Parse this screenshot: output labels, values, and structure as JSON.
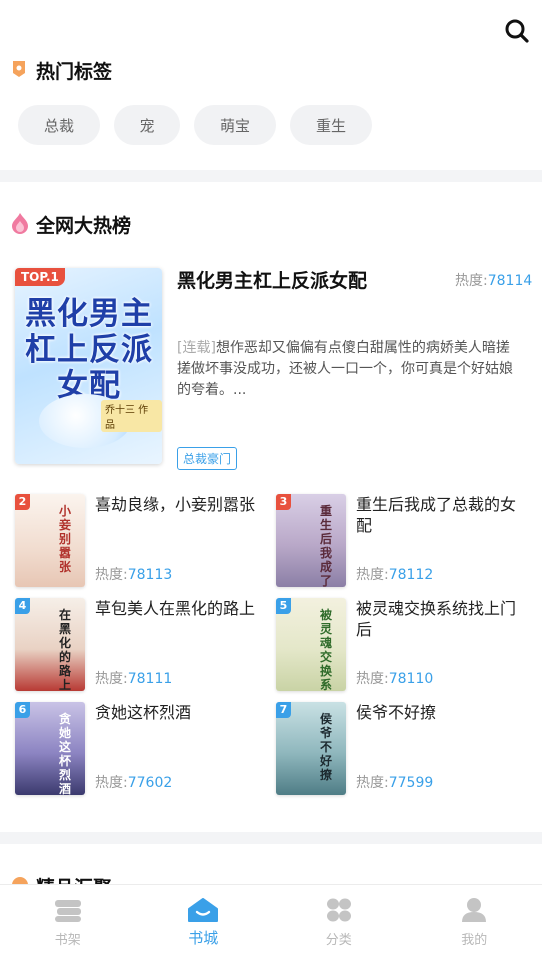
{
  "hot_tags": {
    "title": "热门标签",
    "tags": [
      "总裁",
      "宠",
      "萌宝",
      "重生"
    ]
  },
  "ranking": {
    "title": "全网大热榜",
    "heat_label": "热度:",
    "top1": {
      "badge": "TOP.1",
      "cover_text": "黑化男主杠上反派女配",
      "cover_author": "乔十三 作品",
      "title": "黑化男主杠上反派女配",
      "heat": "78114",
      "status": "[连载]",
      "description": "想作恶却又偏偏有点傻白甜属性的病娇美人暗搓搓做坏事没成功，还被人一口一个，你可真是个好姑娘的夸着。...",
      "category": "总裁豪门"
    },
    "books": [
      {
        "rank": "2",
        "title": "喜劫良缘，小妾别嚣张",
        "heat": "78113",
        "cover_text": "小妾别嚣张"
      },
      {
        "rank": "3",
        "title": "重生后我成了总裁的女配",
        "heat": "78112",
        "cover_text": "重生后我成了总裁的女配"
      },
      {
        "rank": "4",
        "title": "草包美人在黑化的路上",
        "heat": "78111",
        "cover_text": "在黑化的路上"
      },
      {
        "rank": "5",
        "title": "被灵魂交换系统找上门后",
        "heat": "78110",
        "cover_text": "被灵魂交换系统找上门后"
      },
      {
        "rank": "6",
        "title": "贪她这杯烈酒",
        "heat": "77602",
        "cover_text": "贪她这杯烈酒"
      },
      {
        "rank": "7",
        "title": "侯爷不好撩",
        "heat": "77599",
        "cover_text": "侯爷不好撩"
      }
    ]
  },
  "next_section": {
    "title": "精品汇聚"
  },
  "tabbar": {
    "items": [
      {
        "label": "书架",
        "icon": "bookshelf-icon"
      },
      {
        "label": "书城",
        "icon": "bookstore-home-icon"
      },
      {
        "label": "分类",
        "icon": "category-grid-icon"
      },
      {
        "label": "我的",
        "icon": "profile-icon"
      }
    ],
    "active_color": "#3aa0e8",
    "inactive_color": "#b8b8b8"
  }
}
